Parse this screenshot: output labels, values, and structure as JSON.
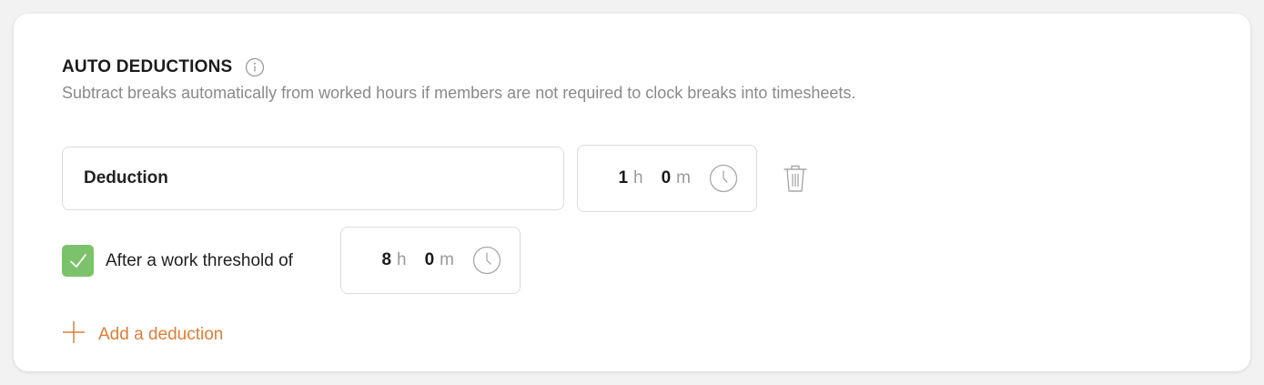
{
  "section": {
    "title": "AUTO DEDUCTIONS",
    "subtitle": "Subtract breaks automatically from worked hours if members are not required to clock breaks into timesheets."
  },
  "deduction": {
    "name": "Deduction",
    "hours": "1",
    "hours_unit": "h",
    "minutes": "0",
    "minutes_unit": "m"
  },
  "threshold": {
    "checked": true,
    "label": "After a work threshold of",
    "hours": "8",
    "hours_unit": "h",
    "minutes": "0",
    "minutes_unit": "m"
  },
  "add_deduction_label": "Add a deduction",
  "colors": {
    "accent": "#e07d35",
    "checkbox": "#7cc26a"
  },
  "icons": {
    "info": "info-icon",
    "clock": "clock-icon",
    "trash": "trash-icon",
    "check": "check-icon",
    "plus": "plus-icon"
  }
}
